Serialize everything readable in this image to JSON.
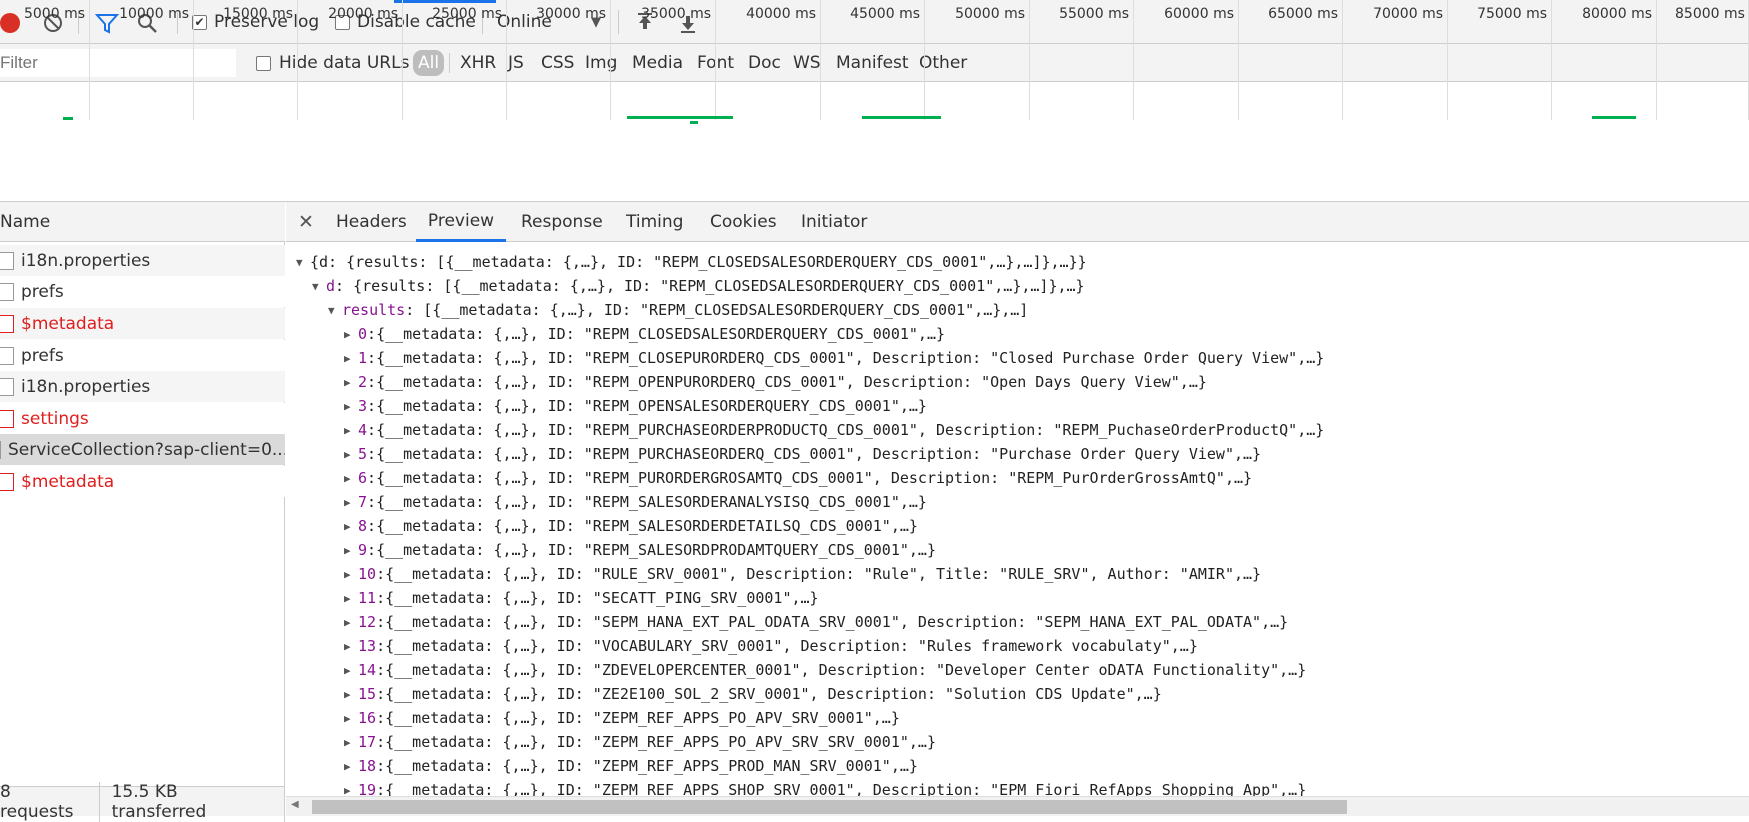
{
  "toolbar": {
    "record_icon": "record-icon",
    "clear_icon": "clear-icon",
    "filter_icon": "filter-icon",
    "search_icon": "search-icon",
    "preserve_log": "Preserve log",
    "preserve_log_checked": true,
    "disable_cache": "Disable cache",
    "disable_cache_checked": false,
    "throttle": "Online",
    "import_icon": "import-icon",
    "export_icon": "export-icon"
  },
  "filterbar": {
    "placeholder": "Filter",
    "hide_data_urls": "Hide data URLs",
    "types": [
      "All",
      "XHR",
      "JS",
      "CSS",
      "Img",
      "Media",
      "Font",
      "Doc",
      "WS",
      "Manifest",
      "Other"
    ],
    "active_type": "All"
  },
  "timeline": {
    "ticks": [
      "5000 ms",
      "10000 ms",
      "15000 ms",
      "20000 ms",
      "25000 ms",
      "30000 ms",
      "35000 ms",
      "40000 ms",
      "45000 ms",
      "50000 ms",
      "55000 ms",
      "60000 ms",
      "65000 ms",
      "70000 ms",
      "75000 ms",
      "80000 ms",
      "85000 ms"
    ]
  },
  "requests": {
    "column_name": "Name",
    "items": [
      {
        "name": "i18n.properties",
        "error": false,
        "selected": false
      },
      {
        "name": "prefs",
        "error": false,
        "selected": false
      },
      {
        "name": "$metadata",
        "error": true,
        "selected": false
      },
      {
        "name": "prefs",
        "error": false,
        "selected": false
      },
      {
        "name": "i18n.properties",
        "error": false,
        "selected": false
      },
      {
        "name": "settings",
        "error": true,
        "selected": false
      },
      {
        "name": "ServiceCollection?sap-client=0...",
        "error": false,
        "selected": true
      },
      {
        "name": "$metadata",
        "error": true,
        "selected": false
      }
    ],
    "status_requests": "8 requests",
    "status_transferred": "15.5 KB transferred"
  },
  "detail_tabs": {
    "close_icon": "close-icon",
    "tabs": [
      "Headers",
      "Preview",
      "Response",
      "Timing",
      "Cookies",
      "Initiator"
    ],
    "active": "Preview"
  },
  "preview": {
    "root": "{d: {results: [{__metadata: {,…}, ID: \"REPM_CLOSEDSALESORDERQUERY_CDS_0001\",…},…]},…}}",
    "d_key": "d",
    "d_value": "{results: [{__metadata: {,…}, ID: \"REPM_CLOSEDSALESORDERQUERY_CDS_0001\",…},…]},…}",
    "results_key": "results",
    "results_value": "[{__metadata: {,…}, ID: \"REPM_CLOSEDSALESORDERQUERY_CDS_0001\",…},…]",
    "rows": [
      {
        "idx": "0",
        "text": "{__metadata: {,…}, ID: \"REPM_CLOSEDSALESORDERQUERY_CDS_0001\",…}"
      },
      {
        "idx": "1",
        "text": "{__metadata: {,…}, ID: \"REPM_CLOSEPURORDERQ_CDS_0001\", Description: \"Closed Purchase Order Query View\",…}"
      },
      {
        "idx": "2",
        "text": "{__metadata: {,…}, ID: \"REPM_OPENPURORDERQ_CDS_0001\", Description: \"Open Days Query View\",…}"
      },
      {
        "idx": "3",
        "text": "{__metadata: {,…}, ID: \"REPM_OPENSALESORDERQUERY_CDS_0001\",…}"
      },
      {
        "idx": "4",
        "text": "{__metadata: {,…}, ID: \"REPM_PURCHASEORDERPRODUCTQ_CDS_0001\", Description: \"REPM_PuchaseOrderProductQ\",…}"
      },
      {
        "idx": "5",
        "text": "{__metadata: {,…}, ID: \"REPM_PURCHASEORDERQ_CDS_0001\", Description: \"Purchase Order Query View\",…}"
      },
      {
        "idx": "6",
        "text": "{__metadata: {,…}, ID: \"REPM_PURORDERGROSAMTQ_CDS_0001\", Description: \"REPM_PurOrderGrossAmtQ\",…}"
      },
      {
        "idx": "7",
        "text": "{__metadata: {,…}, ID: \"REPM_SALESORDERANALYSISQ_CDS_0001\",…}"
      },
      {
        "idx": "8",
        "text": "{__metadata: {,…}, ID: \"REPM_SALESORDERDETAILSQ_CDS_0001\",…}"
      },
      {
        "idx": "9",
        "text": "{__metadata: {,…}, ID: \"REPM_SALESORDPRODAMTQUERY_CDS_0001\",…}"
      },
      {
        "idx": "10",
        "text": "{__metadata: {,…}, ID: \"RULE_SRV_0001\", Description: \"Rule\", Title: \"RULE_SRV\", Author: \"AMIR\",…}"
      },
      {
        "idx": "11",
        "text": "{__metadata: {,…}, ID: \"SECATT_PING_SRV_0001\",…}"
      },
      {
        "idx": "12",
        "text": "{__metadata: {,…}, ID: \"SEPM_HANA_EXT_PAL_ODATA_SRV_0001\", Description: \"SEPM_HANA_EXT_PAL_ODATA\",…}"
      },
      {
        "idx": "13",
        "text": "{__metadata: {,…}, ID: \"VOCABULARY_SRV_0001\", Description: \"Rules framework vocabulaty\",…}"
      },
      {
        "idx": "14",
        "text": "{__metadata: {,…}, ID: \"ZDEVELOPERCENTER_0001\", Description: \"Developer Center oDATA Functionality\",…}"
      },
      {
        "idx": "15",
        "text": "{__metadata: {,…}, ID: \"ZE2E100_SOL_2_SRV_0001\", Description: \"Solution CDS Update\",…}"
      },
      {
        "idx": "16",
        "text": "{__metadata: {,…}, ID: \"ZEPM_REF_APPS_PO_APV_SRV_0001\",…}"
      },
      {
        "idx": "17",
        "text": "{__metadata: {,…}, ID: \"ZEPM_REF_APPS_PO_APV_SRV_SRV_0001\",…}"
      },
      {
        "idx": "18",
        "text": "{__metadata: {,…}, ID: \"ZEPM_REF_APPS_PROD_MAN_SRV_0001\",…}"
      },
      {
        "idx": "19",
        "text": "{__metadata: {,…}, ID: \"ZEPM_REF_APPS_SHOP_SRV_0001\", Description: \"EPM Fiori RefApps Shopping App\",…}"
      }
    ]
  },
  "colors": {
    "accent": "#1a73e8",
    "record": "#d93025",
    "error_text": "#e01e1e",
    "key": "#881391",
    "timeline_bar": "#00b050"
  }
}
